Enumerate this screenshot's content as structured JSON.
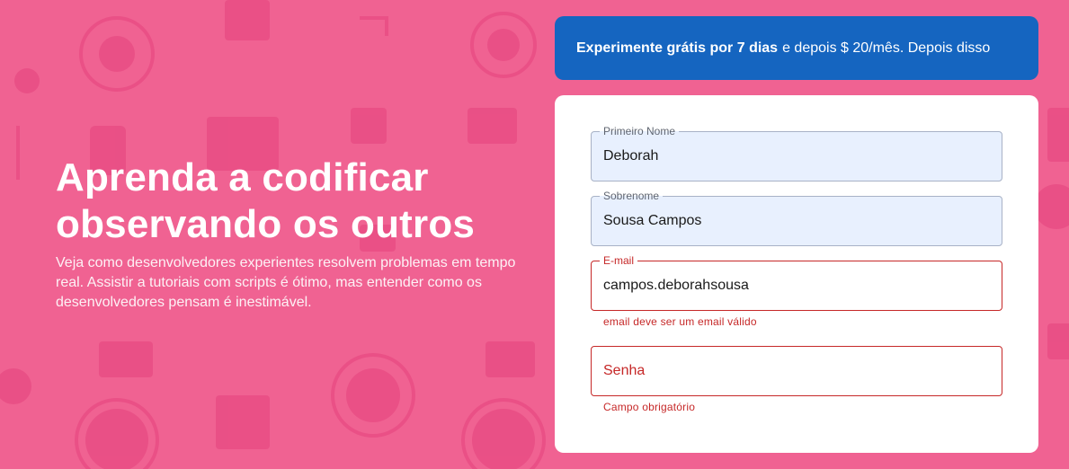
{
  "hero": {
    "title_line1": "Aprenda a codificar",
    "title_line2": "observando os outros",
    "subtitle_line1": "Veja como desenvolvedores experientes resolvem problemas em tempo",
    "subtitle_line2": "real. Assistir a tutoriais com scripts é ótimo, mas entender como os",
    "subtitle_line3": "desenvolvedores pensam é inestimável."
  },
  "trial": {
    "bold": "Experimente grátis por 7 dias",
    "rest": "e depois $ 20/mês. Depois disso"
  },
  "form": {
    "first_name": {
      "label": "Primeiro Nome",
      "value": "Deborah"
    },
    "last_name": {
      "label": "Sobrenome",
      "value": "Sousa Campos"
    },
    "email": {
      "label": "E-mail",
      "value": "campos.deborahsousa",
      "error": "email deve ser um email válido"
    },
    "password": {
      "placeholder": "Senha",
      "error": "Campo obrigatório"
    }
  },
  "colors": {
    "background": "#f06292",
    "trial_banner": "#1565c0",
    "error": "#c62828",
    "autofill": "#e8f0fe"
  }
}
